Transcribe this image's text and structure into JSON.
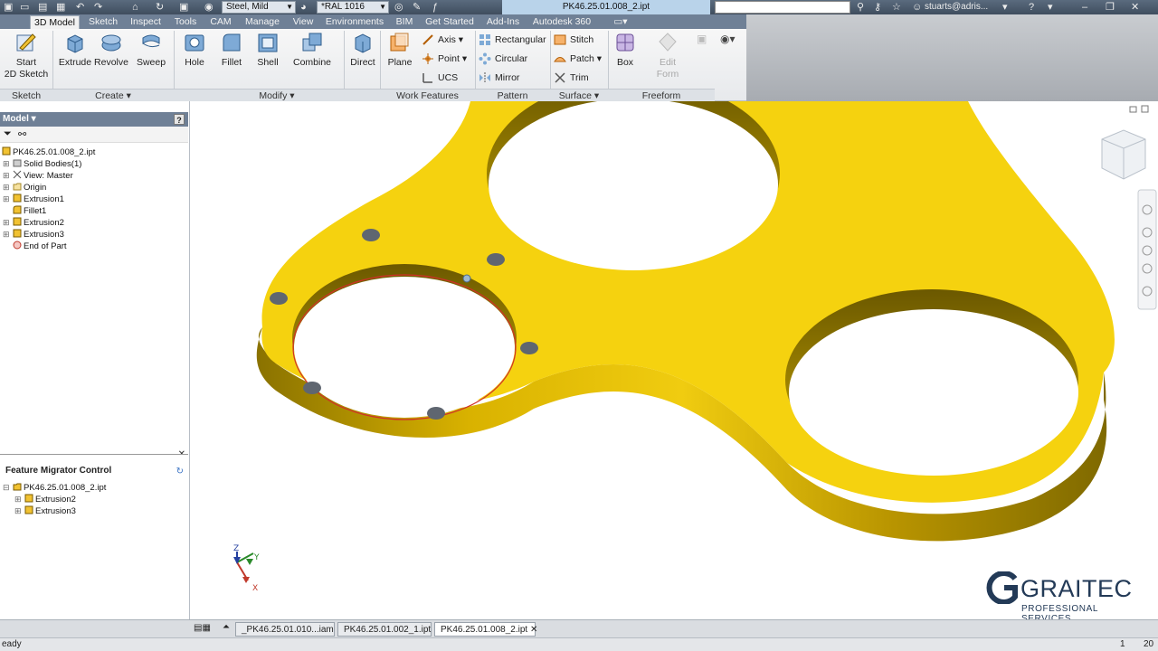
{
  "titlebar": {
    "material": "Steel, Mild",
    "appearance": "*RAL 1016",
    "document_title": "PK46.25.01.008_2.ipt",
    "user": "stuarts@adris..."
  },
  "ribbon_tabs": [
    "3D Model",
    "Sketch",
    "Inspect",
    "Tools",
    "CAM",
    "Manage",
    "View",
    "Environments",
    "BIM",
    "Get Started",
    "Add-Ins",
    "Autodesk 360"
  ],
  "ribbon": {
    "sketch": {
      "start_line1": "Start",
      "start_line2": "2D Sketch",
      "panel": "Sketch"
    },
    "create": {
      "extrude": "Extrude",
      "revolve": "Revolve",
      "sweep": "Sweep",
      "panel": "Create"
    },
    "modify": {
      "hole": "Hole",
      "fillet": "Fillet",
      "shell": "Shell",
      "combine": "Combine",
      "direct": "Direct",
      "panel": "Modify"
    },
    "work_features": {
      "plane": "Plane",
      "axis": "Axis",
      "point": "Point",
      "ucs": "UCS",
      "panel": "Work Features"
    },
    "pattern": {
      "rectangular": "Rectangular",
      "circular": "Circular",
      "mirror": "Mirror",
      "panel": "Pattern"
    },
    "surface": {
      "stitch": "Stitch",
      "patch": "Patch",
      "trim": "Trim",
      "panel": "Surface"
    },
    "freeform": {
      "box": "Box",
      "edit_line1": "Edit",
      "edit_line2": "Form",
      "panel": "Freeform"
    }
  },
  "browser": {
    "title": "Model",
    "tree": [
      {
        "label": "PK46.25.01.008_2.ipt"
      },
      {
        "label": "Solid Bodies(1)"
      },
      {
        "label": "View: Master"
      },
      {
        "label": "Origin"
      },
      {
        "label": "Extrusion1"
      },
      {
        "label": "Fillet1"
      },
      {
        "label": "Extrusion2"
      },
      {
        "label": "Extrusion3"
      },
      {
        "label": "End of Part"
      }
    ]
  },
  "feature_migrator": {
    "title": "Feature Migrator Control",
    "tree": [
      {
        "label": "PK46.25.01.008_2.ipt"
      },
      {
        "label": "Extrusion2"
      },
      {
        "label": "Extrusion3"
      }
    ]
  },
  "document_tabs": [
    "_PK46.25.01.010...iam",
    "PK46.25.01.002_1.ipt",
    "PK46.25.01.008_2.ipt"
  ],
  "active_document_tab": 2,
  "status": {
    "left": "eady",
    "num1": "1",
    "num2": "20"
  },
  "axis_labels": {
    "x": "X",
    "y": "Y",
    "z": "Z"
  },
  "logo": {
    "name": "GRAITEC",
    "tagline": "PROFESSIONAL SERVICES"
  },
  "colors": {
    "part": "#f5d20f",
    "part_edge": "#9a7f00",
    "accent": "#e87722",
    "ribbon_tab": "#6f8096"
  }
}
